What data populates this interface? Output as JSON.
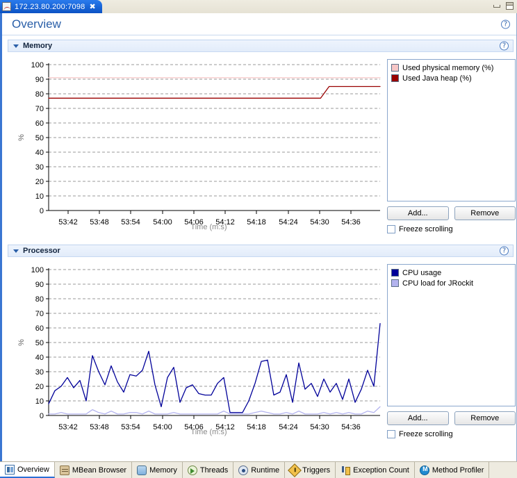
{
  "window": {
    "tab_label": "172.23.80.200:7098",
    "tab_close": "✖",
    "tab_icon": "chart-icon",
    "minimize_icon": "minimize-icon",
    "maximize_icon": "maximize-icon"
  },
  "page": {
    "title": "Overview",
    "help_icon": "?"
  },
  "sections": {
    "memory": {
      "title": "Memory",
      "help_icon": "?",
      "add_label": "Add...",
      "remove_label": "Remove",
      "freeze_label": "Freeze scrolling",
      "freeze_checked": false
    },
    "processor": {
      "title": "Processor",
      "help_icon": "?",
      "add_label": "Add...",
      "remove_label": "Remove",
      "freeze_label": "Freeze scrolling",
      "freeze_checked": false
    }
  },
  "bottom_tabs": [
    {
      "label": "Overview",
      "icon": "overview-icon",
      "active": true
    },
    {
      "label": "MBean Browser",
      "icon": "mbean-icon",
      "active": false
    },
    {
      "label": "Memory",
      "icon": "memory-icon",
      "active": false
    },
    {
      "label": "Threads",
      "icon": "threads-icon",
      "active": false
    },
    {
      "label": "Runtime",
      "icon": "runtime-icon",
      "active": false
    },
    {
      "label": "Triggers",
      "icon": "triggers-icon",
      "active": false
    },
    {
      "label": "Exception Count",
      "icon": "exception-icon",
      "active": false
    },
    {
      "label": "Method Profiler",
      "icon": "method-profiler-icon",
      "active": false
    }
  ],
  "colors": {
    "accent": "#2a5fa8",
    "tab_blue": "#1663d6",
    "used_physical_memory": "#f6c6c6",
    "used_java_heap": "#990000",
    "cpu_usage": "#000099",
    "cpu_load_jrockit": "#b3b3ee",
    "grid": "#9a9a9a",
    "axis": "#000000"
  },
  "chart_data": [
    {
      "type": "line",
      "id": "memory-chart",
      "title": "Memory",
      "xlabel": "Time (m:s)",
      "ylabel": "%",
      "ylim": [
        0,
        100
      ],
      "yticks": [
        0,
        10,
        20,
        30,
        40,
        50,
        60,
        70,
        80,
        90,
        100
      ],
      "xticks": [
        "53:42",
        "53:48",
        "53:54",
        "54:00",
        "54:06",
        "54:12",
        "54:18",
        "54:24",
        "54:30",
        "54:36"
      ],
      "grid": true,
      "legend_position": "right",
      "series": [
        {
          "name": "Used physical memory (%)",
          "color": "#f6c6c6",
          "values": [
            91,
            91,
            91,
            91,
            91,
            91,
            91,
            91,
            91,
            91,
            91,
            91,
            91,
            91,
            91,
            91,
            91,
            91,
            91,
            91,
            91,
            91,
            91,
            91,
            91,
            91,
            91,
            91,
            91,
            91,
            91,
            91,
            91,
            91,
            91,
            91,
            91,
            91,
            91,
            91
          ]
        },
        {
          "name": "Used Java heap (%)",
          "color": "#990000",
          "values": [
            77,
            77,
            77,
            77,
            77,
            77,
            77,
            77,
            77,
            77,
            77,
            77,
            77,
            77,
            77,
            77,
            77,
            77,
            77,
            77,
            77,
            77,
            77,
            77,
            77,
            77,
            77,
            77,
            77,
            77,
            77,
            77,
            77,
            85,
            85,
            85,
            85,
            85,
            85,
            85
          ]
        }
      ]
    },
    {
      "type": "line",
      "id": "processor-chart",
      "title": "Processor",
      "xlabel": "Time (m:s)",
      "ylabel": "%",
      "ylim": [
        0,
        100
      ],
      "yticks": [
        0,
        10,
        20,
        30,
        40,
        50,
        60,
        70,
        80,
        90,
        100
      ],
      "xticks": [
        "53:42",
        "53:48",
        "53:54",
        "54:00",
        "54:06",
        "54:12",
        "54:18",
        "54:24",
        "54:30",
        "54:36"
      ],
      "grid": true,
      "legend_position": "right",
      "series": [
        {
          "name": "CPU usage",
          "color": "#000099",
          "values": [
            8,
            17,
            20,
            26,
            19,
            24,
            10,
            41,
            30,
            21,
            34,
            23,
            16,
            28,
            27,
            31,
            44,
            21,
            6,
            26,
            33,
            9,
            19,
            21,
            15,
            14,
            14,
            22,
            26,
            2,
            2,
            2,
            10,
            22,
            37,
            38,
            14,
            16,
            28,
            9,
            36,
            18,
            22,
            13,
            25,
            16,
            22,
            11,
            25,
            9,
            18,
            31,
            20,
            63
          ]
        },
        {
          "name": "CPU load for JRockit",
          "color": "#b3b3ee",
          "values": [
            1,
            1,
            2,
            1,
            1,
            1,
            1,
            4,
            2,
            1,
            3,
            1,
            1,
            2,
            2,
            1,
            3,
            1,
            1,
            1,
            2,
            1,
            1,
            1,
            1,
            1,
            1,
            1,
            3,
            1,
            1,
            1,
            1,
            2,
            3,
            2,
            1,
            1,
            2,
            1,
            3,
            1,
            1,
            1,
            2,
            1,
            2,
            1,
            2,
            1,
            1,
            3,
            2,
            6
          ]
        }
      ]
    }
  ]
}
